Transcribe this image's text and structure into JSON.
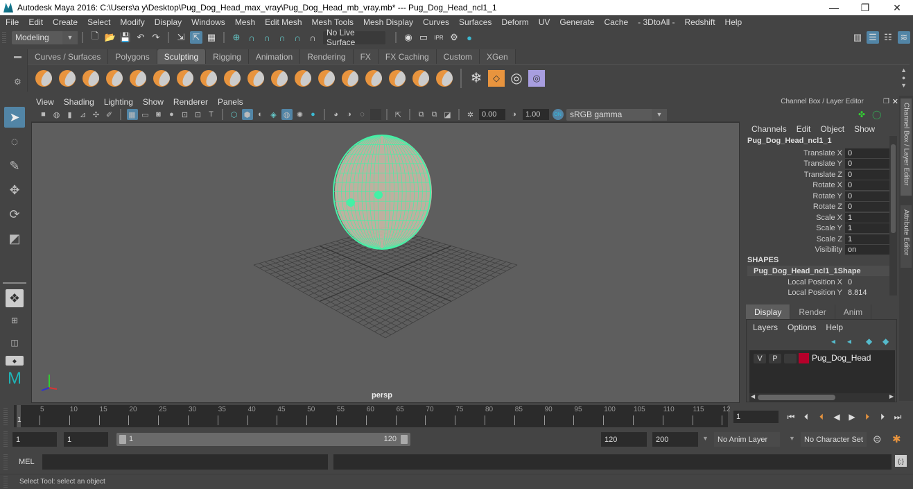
{
  "window": {
    "title": "Autodesk Maya 2016: C:\\Users\\a y\\Desktop\\Pug_Dog_Head_max_vray\\Pug_Dog_Head_mb_vray.mb*  ---  Pug_Dog_Head_ncl1_1",
    "minimize": "—",
    "maximize": "❐",
    "close": "✕"
  },
  "menubar": [
    "File",
    "Edit",
    "Create",
    "Select",
    "Modify",
    "Display",
    "Windows",
    "Mesh",
    "Edit Mesh",
    "Mesh Tools",
    "Mesh Display",
    "Curves",
    "Surfaces",
    "Deform",
    "UV",
    "Generate",
    "Cache",
    "- 3DtoAll -",
    "Redshift",
    "Help"
  ],
  "statusline": {
    "mode": "Modeling",
    "live_surface": "No Live Surface",
    "icons": [
      "new-scene-icon",
      "open-scene-icon",
      "save-scene-icon",
      "undo-icon",
      "redo-icon",
      "select-hierarchy-icon",
      "select-object-icon",
      "select-component-icon",
      "snap-grid-icon",
      "snap-curve-icon",
      "snap-point-icon",
      "snap-projected-center-icon",
      "snap-view-plane-icon",
      "make-live-icon",
      "render-view-icon",
      "render-frame-icon",
      "ipr-render-icon",
      "render-settings-icon",
      "hypershade-icon"
    ]
  },
  "shelf": {
    "tabs": [
      "Curves / Surfaces",
      "Polygons",
      "Sculpting",
      "Rigging",
      "Animation",
      "Rendering",
      "FX",
      "FX Caching",
      "Custom",
      "XGen"
    ],
    "active_tab": "Sculpting",
    "tools": [
      "sculpt-tool",
      "smooth-tool",
      "relax-tool",
      "grab-tool",
      "pinch-tool",
      "flatten-tool",
      "foamy-tool",
      "spray-tool",
      "repeat-tool",
      "imprint-tool",
      "wax-tool",
      "scrape-tool",
      "fill-tool",
      "knife-tool",
      "smear-tool",
      "bulge-tool",
      "amplify-tool",
      "freeze-tool"
    ],
    "extra_tools": [
      "convert-to-frozen-icon",
      "sculpt-geometry-icon",
      "mesh-layer-icon",
      "create-blend-shape-icon"
    ]
  },
  "toolbox": [
    "select-tool",
    "lasso-tool",
    "paint-select-tool",
    "move-tool",
    "rotate-tool",
    "scale-tool"
  ],
  "viewport": {
    "menu": [
      "View",
      "Shading",
      "Lighting",
      "Show",
      "Renderer",
      "Panels"
    ],
    "exposure": "0.00",
    "gamma": "1.00",
    "color_space_toggle": "ON",
    "color_space": "sRGB gamma",
    "camera_label": "persp",
    "axis": {
      "x": "x",
      "y": "y",
      "z": "z"
    }
  },
  "channel_box": {
    "header": "Channel Box / Layer Editor",
    "menu": [
      "Channels",
      "Edit",
      "Object",
      "Show"
    ],
    "object_name": "Pug_Dog_Head_ncl1_1",
    "channels": [
      {
        "label": "Translate X",
        "value": "0"
      },
      {
        "label": "Translate Y",
        "value": "0"
      },
      {
        "label": "Translate Z",
        "value": "0"
      },
      {
        "label": "Rotate X",
        "value": "0"
      },
      {
        "label": "Rotate Y",
        "value": "0"
      },
      {
        "label": "Rotate Z",
        "value": "0"
      },
      {
        "label": "Scale X",
        "value": "1"
      },
      {
        "label": "Scale Y",
        "value": "1"
      },
      {
        "label": "Scale Z",
        "value": "1"
      },
      {
        "label": "Visibility",
        "value": "on"
      }
    ],
    "shapes_header": "SHAPES",
    "shape_name": "Pug_Dog_Head_ncl1_1Shape",
    "shape_channels": [
      {
        "label": "Local Position X",
        "value": "0"
      },
      {
        "label": "Local Position Y",
        "value": "8.814"
      }
    ]
  },
  "side_tabs": [
    "Channel Box / Layer Editor",
    "Attribute Editor"
  ],
  "layer_editor": {
    "tabs": [
      "Display",
      "Render",
      "Anim"
    ],
    "active_tab": "Display",
    "menu": [
      "Layers",
      "Options",
      "Help"
    ],
    "layers": [
      {
        "v": "V",
        "p": "P",
        "name": "Pug_Dog_Head",
        "color": "#b5002a"
      }
    ]
  },
  "timeline": {
    "ticks": [
      "5",
      "10",
      "15",
      "20",
      "25",
      "30",
      "35",
      "40",
      "45",
      "50",
      "55",
      "60",
      "65",
      "70",
      "75",
      "80",
      "85",
      "90",
      "95",
      "100",
      "105",
      "110",
      "115",
      "12"
    ],
    "start_label": "1",
    "current_frame": "1"
  },
  "range": {
    "start": "1",
    "playback_start": "1",
    "slider_start": "1",
    "slider_end": "120",
    "playback_end": "120",
    "end": "200",
    "anim_layer": "No Anim Layer",
    "character_set": "No Character Set"
  },
  "command_line": {
    "label": "MEL"
  },
  "status": "Select Tool: select an object"
}
